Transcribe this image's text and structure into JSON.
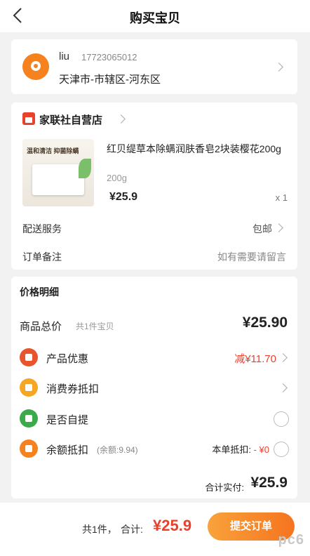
{
  "nav": {
    "title": "购买宝贝"
  },
  "address": {
    "name": "liu",
    "phone": "17723065012",
    "line": "天津市-市辖区-河东区"
  },
  "shop": {
    "name": "家联社自营店",
    "product": {
      "title": "红贝缇草本除螨润肤香皂2块装樱花200g",
      "spec": "200g",
      "price": "¥25.9",
      "qty": "x 1",
      "thumb_text": "温和清洁 抑菌除螨"
    },
    "delivery": {
      "label": "配送服务",
      "value": "包邮"
    },
    "note": {
      "label": "订单备注",
      "placeholder": "如有需要请留言"
    }
  },
  "price_detail": {
    "heading": "价格明细",
    "goods_total_label": "商品总价",
    "goods_total_sub": "共1件宝贝",
    "goods_total_value": "¥25.90",
    "promo_label": "产品优惠",
    "promo_value": "减¥11.70",
    "coupon_label": "消费券抵扣",
    "self_pickup_label": "是否自提",
    "balance_label": "余额抵扣",
    "balance_sub": "(余额:9.94)",
    "balance_deduct_label": "本单抵扣:",
    "balance_deduct_value": "- ¥0",
    "paid_label": "合计实付:",
    "paid_value": "¥25.9"
  },
  "bottom": {
    "count": "共1件，",
    "total_label": "合计:",
    "total_value": "¥25.9",
    "submit": "提交订单",
    "watermark": "pc6"
  },
  "colors": {
    "accent": "#f5811f",
    "price_red": "#e8412c",
    "background": "#f2f2f2"
  }
}
